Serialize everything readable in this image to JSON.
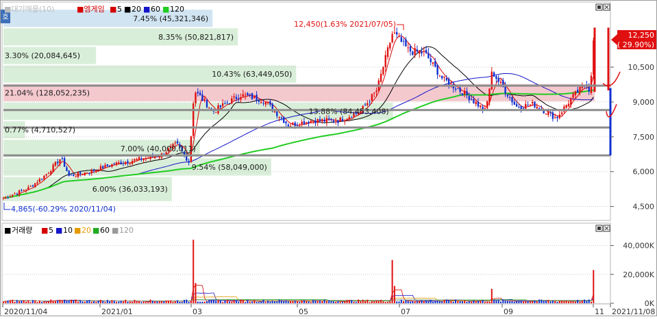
{
  "price_panel": {
    "legend": {
      "prefix": "■대기매물(10)",
      "stock": "■엠게임",
      "ma": [
        "5",
        "20",
        "60",
        "120"
      ],
      "ma_colors": [
        "#d40000",
        "#000000",
        "#1414c8",
        "#22cc22"
      ]
    },
    "side_tab": "호",
    "current_price": {
      "price": "12,250",
      "change": "( 29.90%)"
    },
    "high_annotation": "12,450(1.63% 2021/07/05)",
    "low_annotation": "4,865(-60.29% 2020/11/04)"
  },
  "volume_panel": {
    "legend": {
      "title": "거래량",
      "ma": [
        "5",
        "10",
        "20",
        "60",
        "120"
      ],
      "ma_colors": [
        "#d40000",
        "#1414c8",
        "#e59a00",
        "#22aa22",
        "#999999"
      ]
    }
  },
  "x_axis": {
    "ticks": [
      "2020/11/04",
      "2021/01",
      "03",
      "05",
      "07",
      "09",
      "11",
      "2021/11/08"
    ]
  },
  "colors": {
    "up": "#e01010",
    "down": "#1030d0",
    "profile_blue": "#c9dff0",
    "profile_green": "#d2ebd2",
    "profile_red": "#f3c3c9",
    "support_line": "#8c8c8c",
    "label_red": "#e01010"
  },
  "chart_data": [
    {
      "type": "candlestick",
      "title": "엠게임",
      "x_start": "2020/11/04",
      "x_end": "2021/11/08",
      "y_ticks": [
        "4,500",
        "6,000",
        "7,500",
        "9,000",
        "10,500"
      ],
      "ylim": [
        3900,
        13300
      ],
      "series": [
        {
          "name": "close",
          "points": [
            [
              "2020/11/04",
              4865
            ],
            [
              "2020/11/20",
              5300
            ],
            [
              "2020/12/01",
              5900
            ],
            [
              "2020/12/10",
              6600
            ],
            [
              "2020/12/15",
              5800
            ],
            [
              "2020/12/28",
              6000
            ],
            [
              "2021/01/10",
              6300
            ],
            [
              "2021/01/25",
              6500
            ],
            [
              "2021/02/10",
              6700
            ],
            [
              "2021/02/20",
              7200
            ],
            [
              "2021/02/28",
              6400
            ],
            [
              "2021/03/03",
              9500
            ],
            [
              "2021/03/15",
              8600
            ],
            [
              "2021/04/01",
              9300
            ],
            [
              "2021/04/15",
              9100
            ],
            [
              "2021/05/01",
              8000
            ],
            [
              "2021/05/15",
              8200
            ],
            [
              "2021/06/01",
              8200
            ],
            [
              "2021/06/15",
              8600
            ],
            [
              "2021/06/25",
              9500
            ],
            [
              "2021/07/05",
              12000
            ],
            [
              "2021/07/15",
              11200
            ],
            [
              "2021/07/25",
              11100
            ],
            [
              "2021/08/05",
              10000
            ],
            [
              "2021/08/20",
              9300
            ],
            [
              "2021/09/01",
              8600
            ],
            [
              "2021/09/05",
              10300
            ],
            [
              "2021/09/20",
              8800
            ],
            [
              "2021/10/01",
              8900
            ],
            [
              "2021/10/15",
              8300
            ],
            [
              "2021/10/25",
              9200
            ],
            [
              "2021/11/03",
              9800
            ],
            [
              "2021/11/05",
              9430
            ],
            [
              "2021/11/08",
              12250
            ]
          ]
        }
      ],
      "volume_profile": [
        {
          "price_low": 12200,
          "price_high": 13000,
          "label": "7.45% (45,321,346)"
        },
        {
          "price_low": 11400,
          "price_high": 12200,
          "label": "8.35% (50,821,817)"
        },
        {
          "price_low": 10600,
          "price_high": 11400,
          "label": "3.30% (20,084,645)"
        },
        {
          "price_low": 9800,
          "price_high": 10600,
          "label": "10.43% (63,449,050)"
        },
        {
          "price_low": 9000,
          "price_high": 9800,
          "label": "21.04% (128,052,235)"
        },
        {
          "price_low": 8200,
          "price_high": 9000,
          "label": "13.88% (84,453,408)"
        },
        {
          "price_low": 7400,
          "price_high": 8200,
          "label": "0.77% (4,710,527)"
        },
        {
          "price_low": 6600,
          "price_high": 7400,
          "label": "7.00% (40,000,011)"
        },
        {
          "price_low": 5800,
          "price_high": 6600,
          "label": "9.54% (58,049,000)"
        },
        {
          "price_low": 4700,
          "price_high": 5800,
          "label": "6.00% (36,033,193)"
        }
      ],
      "support_lines": [
        9700,
        8650,
        7900,
        6700
      ]
    },
    {
      "type": "bar",
      "title": "거래량",
      "y_ticks": [
        "0K",
        "20,000K",
        "40,000K"
      ],
      "ylim": [
        0,
        46000
      ],
      "spikes": [
        [
          "2021/03/03",
          44000
        ],
        [
          "2021/03/04",
          14000
        ],
        [
          "2021/07/05",
          30000
        ],
        [
          "2021/07/06",
          12000
        ],
        [
          "2021/09/05",
          10000
        ],
        [
          "2021/11/08",
          23000
        ]
      ]
    }
  ]
}
